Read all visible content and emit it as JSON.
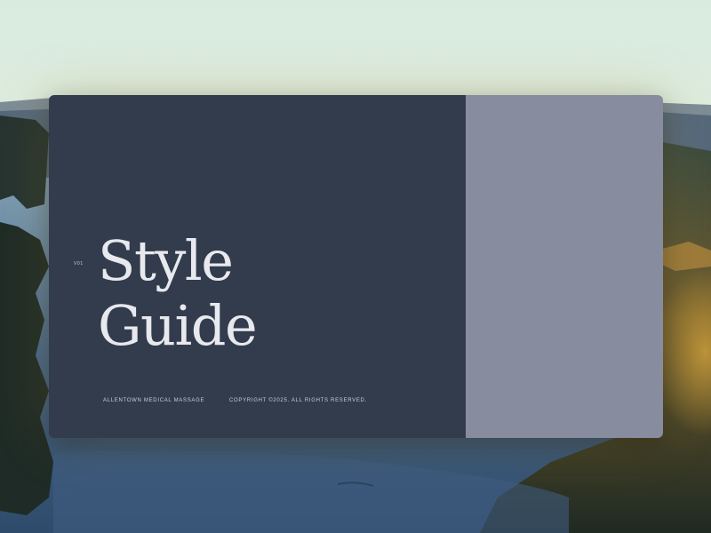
{
  "slide": {
    "version": "V01",
    "title_line1": "Style",
    "title_line2": "Guide",
    "company": "ALLENTOWN MEDICAL MASSAGE",
    "copyright": "COPYRIGHT ©2025. ALL RIGHTS RESERVED."
  },
  "colors": {
    "card_left": "#323c4d",
    "card_right": "#888c9f",
    "title_text": "#e8e9ee"
  }
}
